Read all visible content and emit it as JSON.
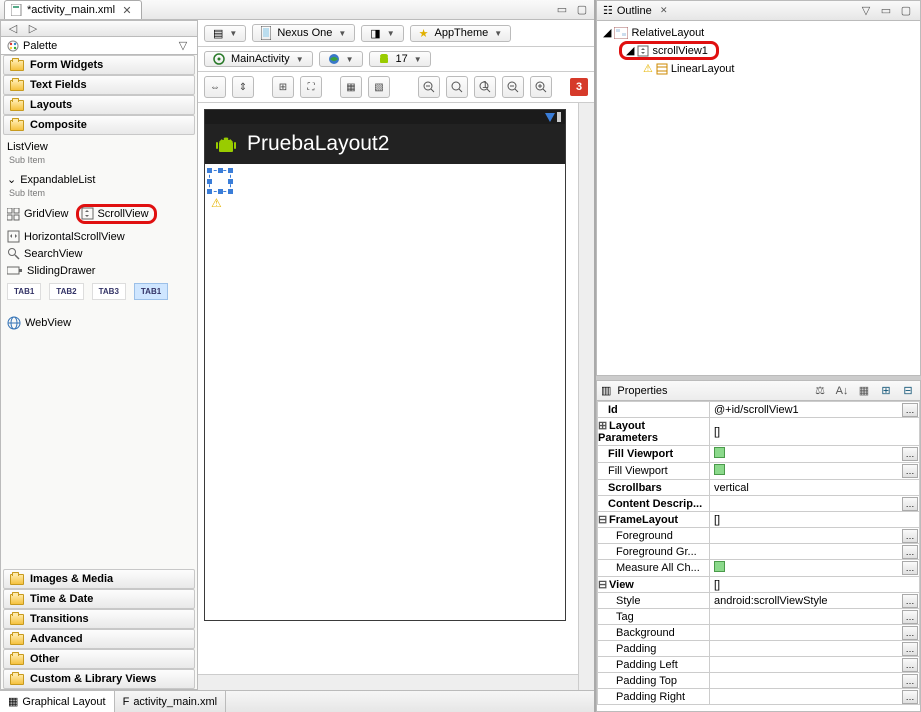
{
  "editor_tab": "*activity_main.xml",
  "palette": {
    "title": "Palette",
    "drawers_top": [
      "Form Widgets",
      "Text Fields",
      "Layouts",
      "Composite"
    ],
    "composite": {
      "listview": "ListView",
      "sub": "Sub Item",
      "expandable": "ExpandableList",
      "gridview": "GridView",
      "scrollview": "ScrollView",
      "hscroll": "HorizontalScrollView",
      "search": "SearchView",
      "sliding": "SlidingDrawer",
      "tabs": [
        "TAB1",
        "TAB2",
        "TAB3",
        "TAB1"
      ],
      "webview": "WebView"
    },
    "drawers_bottom": [
      "Images & Media",
      "Time & Date",
      "Transitions",
      "Advanced",
      "Other",
      "Custom & Library Views"
    ]
  },
  "toolbar": {
    "device": "Nexus One",
    "theme": "AppTheme",
    "activity": "MainActivity",
    "api": "17",
    "badge": "3"
  },
  "app_title": "PruebaLayout2",
  "bottom_tabs": {
    "graphical": "Graphical Layout",
    "xml": "activity_main.xml"
  },
  "outline": {
    "title": "Outline",
    "root": "RelativeLayout",
    "scroll": "scrollView1",
    "linear": "LinearLayout"
  },
  "properties": {
    "title": "Properties",
    "rows": [
      {
        "k": "Id",
        "v": "@+id/scrollView1",
        "btn": true,
        "bold": true
      },
      {
        "k": "Layout Parameters",
        "v": "[]",
        "plus": "+",
        "bold": true
      },
      {
        "k": "Fill Viewport",
        "v": "",
        "green": true,
        "btn": true,
        "bold": true
      },
      {
        "k": "Fill Viewport",
        "v": "",
        "green": true,
        "btn": true
      },
      {
        "k": "Scrollbars",
        "v": "vertical",
        "bold": true
      },
      {
        "k": "Content Descrip...",
        "v": "",
        "btn": true,
        "bold": true
      },
      {
        "k": "FrameLayout",
        "v": "[]",
        "plus": "-",
        "group": true
      },
      {
        "k": "Foreground",
        "v": "",
        "btn": true,
        "indent": true
      },
      {
        "k": "Foreground Gr...",
        "v": "",
        "btn": true,
        "indent": true
      },
      {
        "k": "Measure All Ch...",
        "v": "",
        "green": true,
        "btn": true,
        "indent": true
      },
      {
        "k": "View",
        "v": "[]",
        "plus": "-",
        "group": true
      },
      {
        "k": "Style",
        "v": "android:scrollViewStyle",
        "btn": true,
        "indent": true
      },
      {
        "k": "Tag",
        "v": "",
        "btn": true,
        "indent": true
      },
      {
        "k": "Background",
        "v": "",
        "btn": true,
        "indent": true
      },
      {
        "k": "Padding",
        "v": "",
        "btn": true,
        "indent": true
      },
      {
        "k": "Padding Left",
        "v": "",
        "btn": true,
        "indent": true
      },
      {
        "k": "Padding Top",
        "v": "",
        "btn": true,
        "indent": true
      },
      {
        "k": "Padding Right",
        "v": "",
        "btn": true,
        "indent": true
      }
    ]
  }
}
